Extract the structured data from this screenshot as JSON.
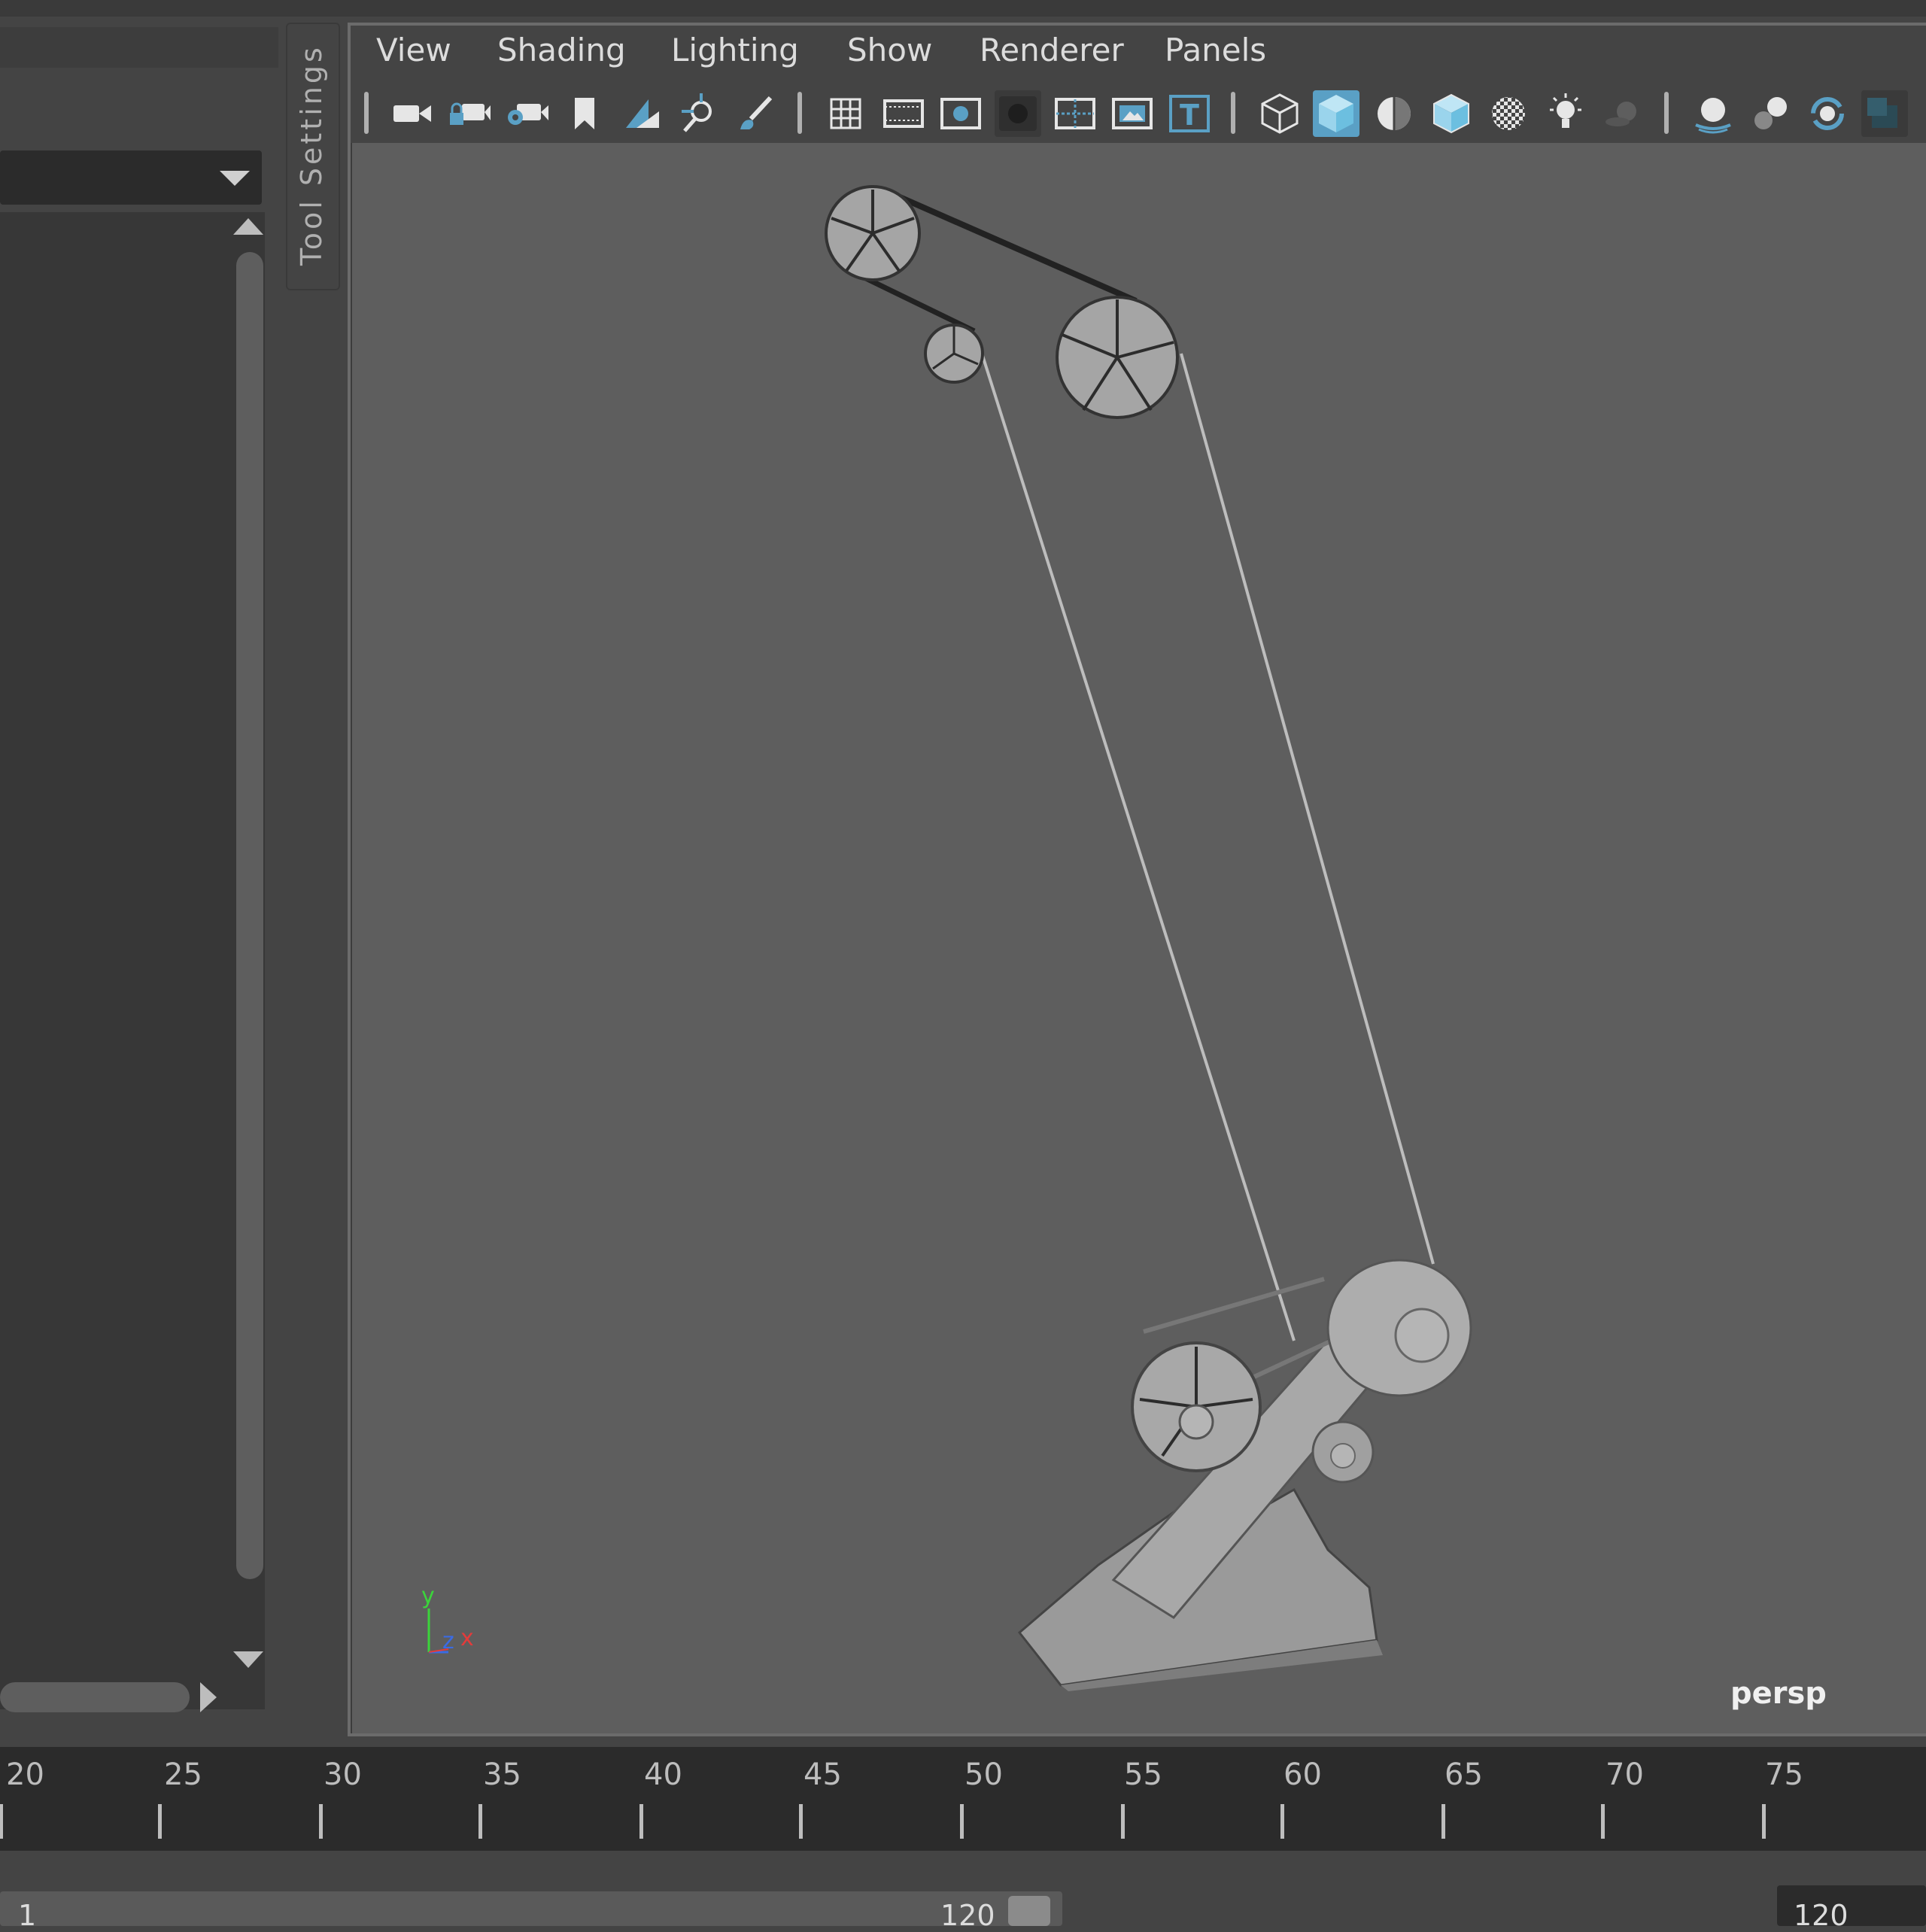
{
  "tool_settings": {
    "label": "Tool Settings"
  },
  "viewport": {
    "menu": [
      "View",
      "Shading",
      "Lighting",
      "Show",
      "Renderer",
      "Panels"
    ],
    "camera_label": "persp",
    "axis_labels": {
      "y": "y",
      "z": "z",
      "x": "x"
    },
    "toolbar_icons": [
      "select-camera-icon",
      "lock-camera-icon",
      "camera-attributes-icon",
      "bookmark-icon",
      "image-plane-icon",
      "track-icon",
      "paint-icon",
      "grid-icon",
      "film-gate-icon",
      "resolution-gate-icon",
      "gate-mask-icon",
      "field-chart-icon",
      "safe-action-icon",
      "safe-title-icon",
      "wireframe-icon",
      "smooth-shade-icon",
      "flat-shade-icon",
      "wireframe-on-shaded-icon",
      "textured-icon",
      "use-lights-icon",
      "shadows-icon",
      "screen-space-ao-icon",
      "motion-blur-icon",
      "anti-aliasing-icon",
      "isolate-select-icon"
    ],
    "active_icon": "smooth-shade-icon"
  },
  "timeline": {
    "ticks": [
      "20",
      "25",
      "30",
      "35",
      "40",
      "45",
      "50",
      "55",
      "60",
      "65",
      "70",
      "75"
    ],
    "range_start": "1",
    "range_end": "120",
    "end_field": "120"
  },
  "colors": {
    "accent": "#5aa0c5",
    "axis_x": "#e33b3b",
    "axis_y": "#3bd43b",
    "axis_z": "#3b6be3"
  }
}
